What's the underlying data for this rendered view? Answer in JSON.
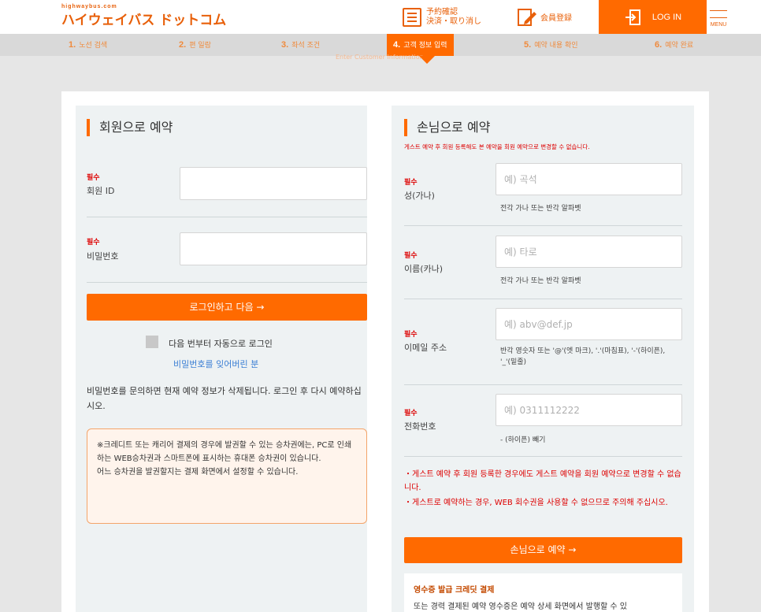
{
  "header": {
    "logo_small": "highwaybus.com",
    "logo_main": "ハイウェイバス ドットコム",
    "reserve_line1": "予約確認",
    "reserve_line2": "決済・取り消し",
    "member_register": "会員登録",
    "login": "LOG IN",
    "menu": "MENU"
  },
  "steps": [
    {
      "num": "1.",
      "label": "노선 검색"
    },
    {
      "num": "2.",
      "label": "편 일람"
    },
    {
      "num": "3.",
      "label": "좌석 조건"
    },
    {
      "num": "4.",
      "label": "고객 정보 입력"
    },
    {
      "num": "5.",
      "label": "예약 내용 확인"
    },
    {
      "num": "6.",
      "label": "예약 완료"
    }
  ],
  "step_subtitle": "Enter Customer Information",
  "member": {
    "title": "회원으로 예약",
    "required": "필수",
    "id_label": "회원 ID",
    "password_label": "비밀번호",
    "login_button": "로그인하고 다음 →",
    "auto_login": "다음 번부터 자동으로 로그인",
    "forgot_password": "비밀번호를 잊어버린 분",
    "notice": "비밀번호를 문의하면 현재 예약 정보가 삭제됩니다. 로그인 후 다시 예약하십시오.",
    "ticket_note": "※크레디트 또는 캐리어 결제의 경우에 발권할 수 있는 승차권에는, PC로 인쇄하는 WEB승차권과 스마트폰에 표시하는 휴대폰 승차권이 있습니다.\n어느 승차권을 발권할지는 결제 화면에서 설정할 수 있습니다."
  },
  "guest": {
    "title": "손님으로 예약",
    "subtitle": "게스트 예약 후 회원 등록해도 본 예약을 회원 예약으로 변경할 수 없습니다.",
    "required": "필수",
    "last_name_label": "성(가나)",
    "last_name_placeholder": "예) 곡석",
    "last_name_hint": "전각 가나 또는 반각 알파벳",
    "first_name_label": "이름(카나)",
    "first_name_placeholder": "예) 타로",
    "first_name_hint": "전각 가나 또는 반각 알파벳",
    "email_label": "이메일 주소",
    "email_placeholder": "예) abv@def.jp",
    "email_hint": "반각 영숫자 또는 '@'(엣 마크), '.'(마침표), '-'(하이픈), '_'(밑줄)",
    "phone_label": "전화번호",
    "phone_placeholder": "예) 0311112222",
    "phone_hint": "- (하이픈) 빼기",
    "note1": "・게스트 예약 후 회원 등록한 경우에도 게스트 예약을 회원 예약으로 변경할 수 없습니다.",
    "note2": "・게스트로 예약하는 경우, WEB 회수권을 사용할 수 없으므로 주의해 주십시오.",
    "guest_button": "손님으로 예약 →",
    "receipt_title": "영수증 발급 크레딧 결제",
    "receipt_text": "또는 경력 결제된 예약 영수증은 예약 상세 화면에서 발행할 수 있"
  },
  "colors": {
    "accent": "#ff6a00",
    "required": "#dd0000",
    "panel": "#eef2f3"
  }
}
